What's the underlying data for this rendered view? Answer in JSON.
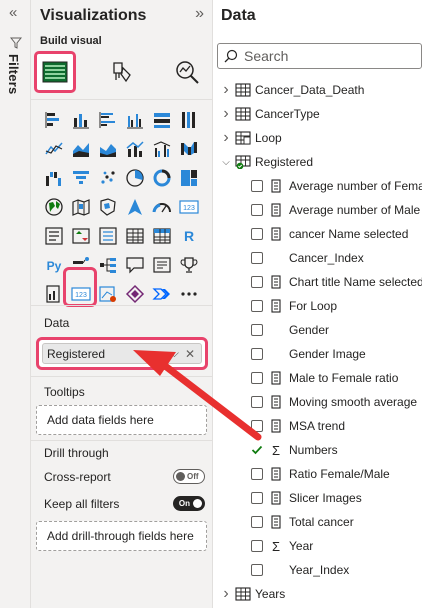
{
  "rail": {
    "collapse_glyph": "«",
    "label": "Filters"
  },
  "visualizations": {
    "title": "Visualizations",
    "expand_glyph": "»",
    "build_visual_label": "Build visual",
    "data_label": "Data",
    "data_field": {
      "name": "Registered",
      "chevron": "⌵",
      "remove": "✕"
    },
    "tooltips_label": "Tooltips",
    "tooltips_placeholder": "Add data fields here",
    "drill_through_label": "Drill through",
    "cross_report_label": "Cross-report",
    "cross_report_state": "Off",
    "keep_filters_label": "Keep all filters",
    "keep_filters_state": "On",
    "drill_placeholder": "Add drill-through fields here"
  },
  "data": {
    "title": "Data",
    "search_placeholder": "Search",
    "tables": [
      {
        "name": "Cancer_Data_Death",
        "expanded": false
      },
      {
        "name": "CancerType",
        "expanded": false
      },
      {
        "name": "Loop",
        "expanded": false
      },
      {
        "name": "Registered",
        "expanded": true
      }
    ],
    "fields": [
      {
        "name": "Average number of Female",
        "icon": "measure-icon",
        "checked": false
      },
      {
        "name": "Average number of Male",
        "icon": "measure-icon",
        "checked": false
      },
      {
        "name": "cancer Name selected",
        "icon": "measure-icon",
        "checked": false
      },
      {
        "name": "Cancer_Index",
        "icon": "none",
        "checked": false
      },
      {
        "name": "Chart title Name selected",
        "icon": "measure-icon",
        "checked": false
      },
      {
        "name": "For Loop",
        "icon": "measure-icon",
        "checked": false
      },
      {
        "name": "Gender",
        "icon": "none",
        "checked": false
      },
      {
        "name": "Gender Image",
        "icon": "none",
        "checked": false
      },
      {
        "name": "Male to Female ratio",
        "icon": "measure-icon",
        "checked": false
      },
      {
        "name": "Moving smooth average",
        "icon": "measure-icon",
        "checked": false
      },
      {
        "name": "MSA trend",
        "icon": "measure-icon",
        "checked": false
      },
      {
        "name": "Numbers",
        "icon": "sigma-icon",
        "checked": true
      },
      {
        "name": "Ratio Female/Male",
        "icon": "measure-icon",
        "checked": false
      },
      {
        "name": "Slicer Images",
        "icon": "measure-icon",
        "checked": false
      },
      {
        "name": "Total cancer",
        "icon": "measure-icon",
        "checked": false
      },
      {
        "name": "Year",
        "icon": "sigma-icon",
        "checked": false
      },
      {
        "name": "Year_Index",
        "icon": "none",
        "checked": false
      }
    ],
    "footer_table": {
      "name": "Years",
      "expanded": false
    }
  },
  "colors": {
    "highlight": "#e8436c",
    "accent_green": "#107c10",
    "pane_bg": "#f3f2f1",
    "checkbox_check": "#2b88d8"
  }
}
